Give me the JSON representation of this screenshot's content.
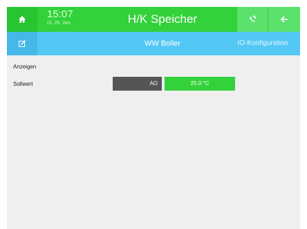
{
  "colors": {
    "topbar": "#33d13a",
    "subbar": "#54c8f5",
    "value_box": "#33d13a",
    "ao_box": "#555555",
    "background": "#efefef"
  },
  "topbar": {
    "time": "15:07",
    "date": "Di, 26. Jan.",
    "title": "H/K Speicher",
    "icons": [
      "home-icon",
      "phone-call-icon",
      "arrow-left-icon"
    ]
  },
  "subbar": {
    "title": "WW Boiler",
    "io_link": "IO-Konfiguration",
    "icons": [
      "edit-icon"
    ]
  },
  "content": {
    "section_label": "Anzeigen",
    "rows": [
      {
        "label": "Sollwert",
        "type_label": "AO",
        "value": "25.0 °C"
      }
    ]
  }
}
